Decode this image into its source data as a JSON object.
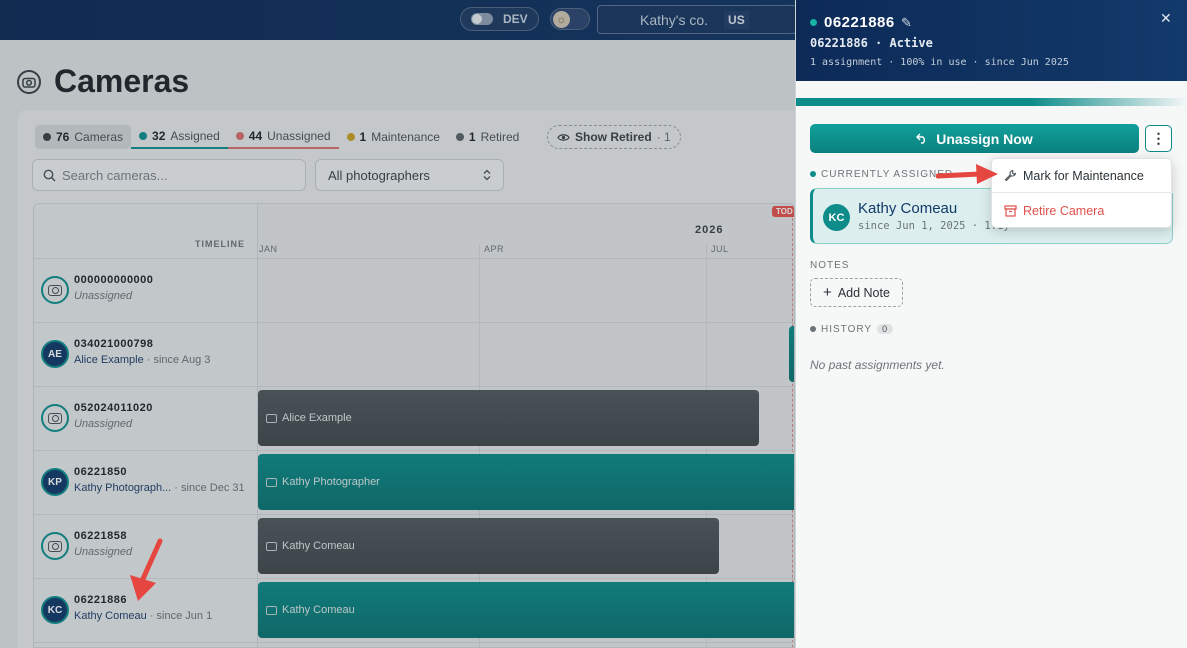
{
  "topbar": {
    "env_label": "DEV",
    "org_name": "Kathy's co.",
    "country": "US"
  },
  "page": {
    "title": "Cameras"
  },
  "filters": {
    "chips": [
      {
        "count": "76",
        "label": "Cameras",
        "color": "#3b4348"
      },
      {
        "count": "32",
        "label": "Assigned",
        "color": "#0e8f8f"
      },
      {
        "count": "44",
        "label": "Unassigned",
        "color": "#d9706e"
      },
      {
        "count": "1",
        "label": "Maintenance",
        "color": "#c9a227"
      },
      {
        "count": "1",
        "label": "Retired",
        "color": "#5a6368"
      }
    ],
    "show_retired_label": "Show Retired",
    "show_retired_count": "· 1",
    "search_placeholder": "Search cameras...",
    "photographer_select": "All photographers"
  },
  "timeline": {
    "header_label": "TIMELINE",
    "year": "2026",
    "months": [
      "JAN",
      "APR",
      "JUL"
    ],
    "today_label": "TOD",
    "rows": [
      {
        "id": "000000000000",
        "who": "Unassigned",
        "since": "",
        "avatar": "",
        "bar": null
      },
      {
        "id": "034021000798",
        "who": "Alice Example",
        "since": "· since Aug 3",
        "avatar": "AE",
        "bar": null
      },
      {
        "id": "052024011020",
        "who": "Unassigned",
        "since": "",
        "avatar": "",
        "bar": {
          "label": "Alice Example",
          "style": "grey"
        }
      },
      {
        "id": "06221850",
        "who": "Kathy Photograph...",
        "since": "· since Dec 31",
        "avatar": "KP",
        "bar": {
          "label": "Kathy Photographer",
          "style": "teal"
        }
      },
      {
        "id": "06221858",
        "who": "Unassigned",
        "since": "",
        "avatar": "",
        "bar": {
          "label": "Kathy Comeau",
          "style": "grey"
        }
      },
      {
        "id": "06221886",
        "who": "Kathy Comeau",
        "since": "· since Jun 1",
        "avatar": "KC",
        "bar": {
          "label": "Kathy Comeau",
          "style": "teal"
        }
      }
    ]
  },
  "drawer": {
    "camera_id": "06221886",
    "status_line": "06221886 · Active",
    "meta_line": "1 assignment · 100% in use · since Jun 2025",
    "usage_percent": 100,
    "unassign_label": "Unassign Now",
    "currently_assigned_label": "CURRENTLY ASSIGNED",
    "assignee_initials": "KC",
    "assignee_name": "Kathy Comeau",
    "assignee_since": "since Jun 1, 2025 · 1.1y",
    "notes_label": "NOTES",
    "add_note_label": "Add Note",
    "history_label": "HISTORY",
    "history_count": "0",
    "history_empty": "No past assignments yet.",
    "menu": {
      "maintenance_label": "Mark for Maintenance",
      "retire_label": "Retire Camera"
    }
  }
}
